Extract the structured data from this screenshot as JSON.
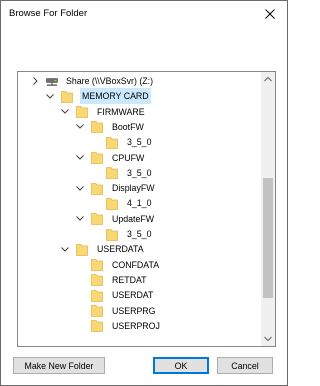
{
  "window": {
    "title": "Browse For Folder"
  },
  "tree": {
    "items": [
      {
        "label": "Share (\\\\VBoxSvr) (Z:)",
        "kind": "drive",
        "level": 0,
        "expander": "right"
      },
      {
        "label": "MEMORY CARD",
        "kind": "folder",
        "level": 1,
        "expander": "down",
        "selected": true
      },
      {
        "label": "FIRMWARE",
        "kind": "folder",
        "level": 2,
        "expander": "down"
      },
      {
        "label": "BootFW",
        "kind": "folder",
        "level": 3,
        "expander": "down"
      },
      {
        "label": "3_5_0",
        "kind": "folder",
        "level": 4,
        "expander": "none"
      },
      {
        "label": "CPUFW",
        "kind": "folder",
        "level": 3,
        "expander": "down"
      },
      {
        "label": "3_5_0",
        "kind": "folder",
        "level": 4,
        "expander": "none"
      },
      {
        "label": "DisplayFW",
        "kind": "folder",
        "level": 3,
        "expander": "down"
      },
      {
        "label": "4_1_0",
        "kind": "folder",
        "level": 4,
        "expander": "none"
      },
      {
        "label": "UpdateFW",
        "kind": "folder",
        "level": 3,
        "expander": "down"
      },
      {
        "label": "3_5_0",
        "kind": "folder",
        "level": 4,
        "expander": "none"
      },
      {
        "label": "USERDATA",
        "kind": "folder",
        "level": 2,
        "expander": "down"
      },
      {
        "label": "CONFDATA",
        "kind": "folder",
        "level": 3,
        "expander": "none"
      },
      {
        "label": "RETDAT",
        "kind": "folder",
        "level": 3,
        "expander": "none"
      },
      {
        "label": "USERDAT",
        "kind": "folder",
        "level": 3,
        "expander": "none"
      },
      {
        "label": "USERPRG",
        "kind": "folder",
        "level": 3,
        "expander": "none"
      },
      {
        "label": "USERPROJ",
        "kind": "folder",
        "level": 3,
        "expander": "none"
      }
    ]
  },
  "buttons": {
    "make_new_folder": "Make New Folder",
    "ok": "OK",
    "cancel": "Cancel"
  },
  "colors": {
    "folder": "#f8d775",
    "folder_dark": "#e8b84a",
    "selection": "#cce8ff",
    "default_border": "#0078d7"
  },
  "icons": {
    "close": "close-icon",
    "folder": "folder-icon",
    "drive": "network-drive-icon",
    "expand": "chevron-down-icon",
    "collapse": "chevron-right-icon"
  }
}
